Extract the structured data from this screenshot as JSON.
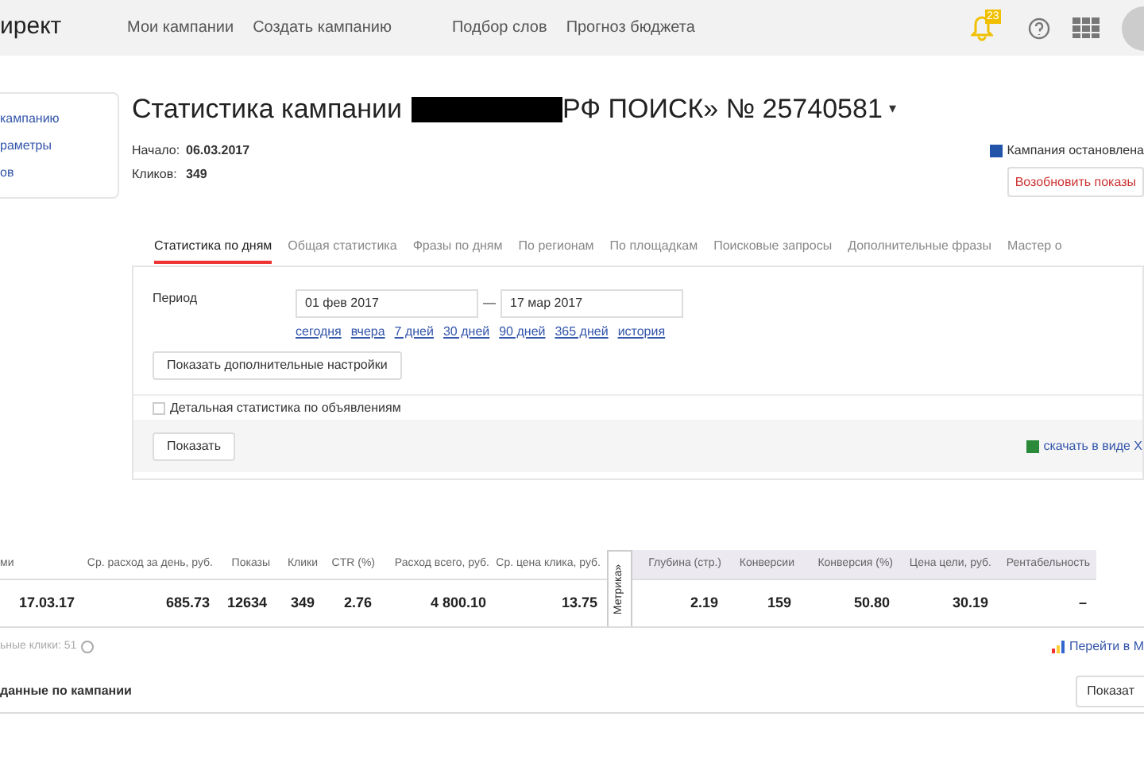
{
  "header": {
    "logo": "ирект",
    "nav": [
      "Мои кампании",
      "Создать кампанию",
      "Подбор слов",
      "Прогноз бюджета"
    ],
    "notification_count": "23"
  },
  "sidebar": {
    "items": [
      "кампанию",
      "раметры",
      "ов"
    ]
  },
  "title": {
    "prefix": "Статистика кампании",
    "suffix": "РФ ПОИСК» № 25740581",
    "caret": "▾"
  },
  "info": [
    {
      "label": "Начало:",
      "value": "06.03.2017"
    },
    {
      "label": "Кликов:",
      "value": "349"
    }
  ],
  "status": {
    "text": "Кампания остановлена",
    "button": "Возобновить показы"
  },
  "tabs": [
    {
      "label": "Статистика по дням",
      "selected": true
    },
    {
      "label": "Общая статистика",
      "selected": false
    },
    {
      "label": "Фразы по дням",
      "selected": false
    },
    {
      "label": "По регионам",
      "selected": false
    },
    {
      "label": "По площадкам",
      "selected": false
    },
    {
      "label": "Поисковые запросы",
      "selected": false
    },
    {
      "label": "Дополнительные фразы",
      "selected": false
    },
    {
      "label": "Мастер о",
      "selected": false
    }
  ],
  "form": {
    "period_label": "Период",
    "date_from": "01 фев 2017",
    "dash": "—",
    "date_to": "17 мар 2017",
    "quick_links": [
      "сегодня",
      "вчера",
      "7 дней",
      "30 дней",
      "90 дней",
      "365 дней",
      "история"
    ],
    "more_settings": "Показать дополнительные настройки",
    "detail_checkbox": {
      "label": "Детальная статистика по объявлениям",
      "checked": false
    },
    "show_button": "Показать",
    "download": "скачать в виде Х"
  },
  "table": {
    "columns": [
      "ми",
      "Ср. расход за день, руб.",
      "Показы",
      "Клики",
      "CTR (%)",
      "Расход всего, руб.",
      "Ср. цена клика, руб.",
      "Метрика»",
      "Глубина (стр.)",
      "Конверсии",
      "Конверсия (%)",
      "Цена цели, руб.",
      "Рентабельность"
    ],
    "rows": [
      [
        "17.03.17",
        "685.73",
        "12634",
        "349",
        "2.76",
        "4 800.10",
        "13.75",
        "",
        "2.19",
        "159",
        "50.80",
        "30.19",
        "–"
      ]
    ]
  },
  "footer": {
    "clicks_note": "ьные клики: 51",
    "metrika_link": "Перейти в М",
    "section_title": "данные по кампании",
    "section_button": "Показат"
  }
}
